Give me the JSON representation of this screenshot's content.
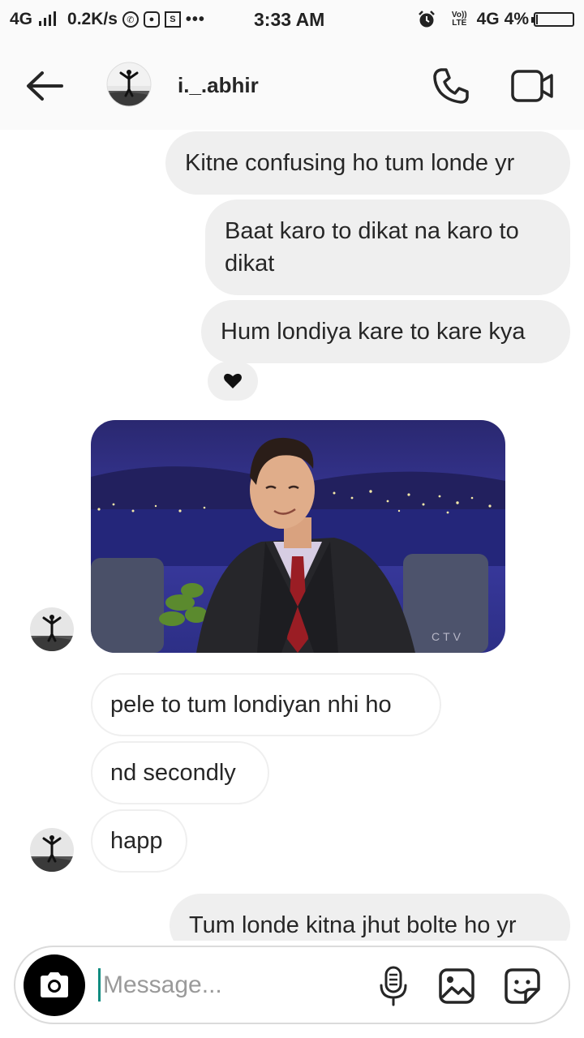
{
  "status_bar": {
    "network": "4G",
    "speed": "0.2K/s",
    "time": "3:33 AM",
    "volte_top": "Vo))",
    "volte_bottom": "LTE",
    "network_right": "4G",
    "battery": "4%",
    "battery_level": 0.04,
    "icons": [
      "signal-icon",
      "whatsapp-icon",
      "instagram-icon",
      "s-notification-icon",
      "more-notifications-icon",
      "alarm-icon",
      "volte-icon",
      "battery-icon"
    ]
  },
  "header": {
    "username": "i._.abhir",
    "icons": [
      "back-arrow-icon",
      "phone-icon",
      "video-camera-icon"
    ]
  },
  "messages": {
    "m1": "Kitne confusing ho tum londe yr",
    "m2": "Baat karo to dikat na karo to dikat",
    "m3": "Hum londiya kare to kare kya",
    "reaction": "❤",
    "gif_watermark": "CTV",
    "m4": "pele to tum londiyan nhi ho",
    "m5": "nd secondly",
    "m6": "happ",
    "m7": "Tum londe kitna jhut bolte ho yr"
  },
  "composer": {
    "placeholder": "Message...",
    "icons": [
      "camera-icon",
      "microphone-icon",
      "gallery-icon",
      "sticker-icon"
    ]
  },
  "colors": {
    "outgoing_bubble": "#efefef",
    "incoming_border": "#efefef",
    "cursor": "#0f8c80",
    "camera_button": "#000000"
  }
}
